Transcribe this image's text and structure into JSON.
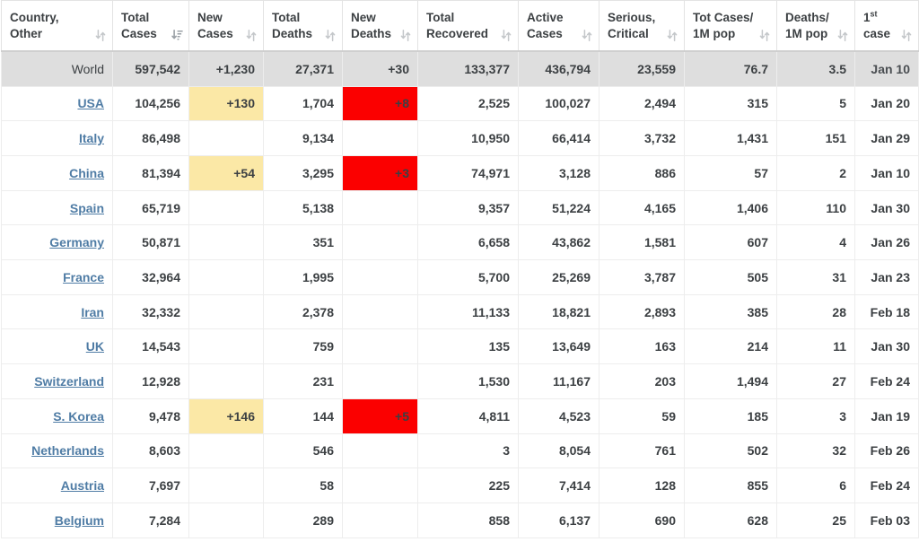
{
  "table": {
    "name": "covid-19-country-statistics-table",
    "columns": [
      {
        "line1": "Country,",
        "line2": "Other",
        "sort": "both",
        "align": "left"
      },
      {
        "line1": "Total",
        "line2": "Cases",
        "sort": "desc",
        "align": "right"
      },
      {
        "line1": "New",
        "line2": "Cases",
        "sort": "both",
        "align": "right"
      },
      {
        "line1": "Total",
        "line2": "Deaths",
        "sort": "both",
        "align": "right"
      },
      {
        "line1": "New",
        "line2": "Deaths",
        "sort": "both",
        "align": "right"
      },
      {
        "line1": "Total",
        "line2": "Recovered",
        "sort": "both",
        "align": "right"
      },
      {
        "line1": "Active",
        "line2": "Cases",
        "sort": "both",
        "align": "right"
      },
      {
        "line1": "Serious,",
        "line2": "Critical",
        "sort": "both",
        "align": "right"
      },
      {
        "line1": "Tot Cases/",
        "line2": "1M pop",
        "sort": "both",
        "align": "right"
      },
      {
        "line1": "Deaths/",
        "line2": "1M pop",
        "sort": "both",
        "align": "right"
      },
      {
        "line1": "1st",
        "line2": "case",
        "sort": "both",
        "align": "right",
        "superscript": "st",
        "base": "1"
      }
    ],
    "rows": [
      {
        "country": "World",
        "is_world": true,
        "is_link": false,
        "total_cases": "597,542",
        "new_cases": "+1,230",
        "total_deaths": "27,371",
        "new_deaths": "+30",
        "total_recovered": "133,377",
        "active_cases": "436,794",
        "serious_critical": "23,559",
        "cases_per_1m": "76.7",
        "deaths_per_1m": "3.5",
        "first_case": "Jan 10",
        "hl_new_cases": false,
        "hl_new_deaths": false
      },
      {
        "country": "USA",
        "is_world": false,
        "is_link": true,
        "total_cases": "104,256",
        "new_cases": "+130",
        "total_deaths": "1,704",
        "new_deaths": "+8",
        "total_recovered": "2,525",
        "active_cases": "100,027",
        "serious_critical": "2,494",
        "cases_per_1m": "315",
        "deaths_per_1m": "5",
        "first_case": "Jan 20",
        "hl_new_cases": true,
        "hl_new_deaths": true
      },
      {
        "country": "Italy",
        "is_world": false,
        "is_link": true,
        "total_cases": "86,498",
        "new_cases": "",
        "total_deaths": "9,134",
        "new_deaths": "",
        "total_recovered": "10,950",
        "active_cases": "66,414",
        "serious_critical": "3,732",
        "cases_per_1m": "1,431",
        "deaths_per_1m": "151",
        "first_case": "Jan 29",
        "hl_new_cases": false,
        "hl_new_deaths": false
      },
      {
        "country": "China",
        "is_world": false,
        "is_link": true,
        "total_cases": "81,394",
        "new_cases": "+54",
        "total_deaths": "3,295",
        "new_deaths": "+3",
        "total_recovered": "74,971",
        "active_cases": "3,128",
        "serious_critical": "886",
        "cases_per_1m": "57",
        "deaths_per_1m": "2",
        "first_case": "Jan 10",
        "hl_new_cases": true,
        "hl_new_deaths": true
      },
      {
        "country": "Spain",
        "is_world": false,
        "is_link": true,
        "total_cases": "65,719",
        "new_cases": "",
        "total_deaths": "5,138",
        "new_deaths": "",
        "total_recovered": "9,357",
        "active_cases": "51,224",
        "serious_critical": "4,165",
        "cases_per_1m": "1,406",
        "deaths_per_1m": "110",
        "first_case": "Jan 30",
        "hl_new_cases": false,
        "hl_new_deaths": false
      },
      {
        "country": "Germany",
        "is_world": false,
        "is_link": true,
        "total_cases": "50,871",
        "new_cases": "",
        "total_deaths": "351",
        "new_deaths": "",
        "total_recovered": "6,658",
        "active_cases": "43,862",
        "serious_critical": "1,581",
        "cases_per_1m": "607",
        "deaths_per_1m": "4",
        "first_case": "Jan 26",
        "hl_new_cases": false,
        "hl_new_deaths": false
      },
      {
        "country": "France",
        "is_world": false,
        "is_link": true,
        "total_cases": "32,964",
        "new_cases": "",
        "total_deaths": "1,995",
        "new_deaths": "",
        "total_recovered": "5,700",
        "active_cases": "25,269",
        "serious_critical": "3,787",
        "cases_per_1m": "505",
        "deaths_per_1m": "31",
        "first_case": "Jan 23",
        "hl_new_cases": false,
        "hl_new_deaths": false
      },
      {
        "country": "Iran",
        "is_world": false,
        "is_link": true,
        "total_cases": "32,332",
        "new_cases": "",
        "total_deaths": "2,378",
        "new_deaths": "",
        "total_recovered": "11,133",
        "active_cases": "18,821",
        "serious_critical": "2,893",
        "cases_per_1m": "385",
        "deaths_per_1m": "28",
        "first_case": "Feb 18",
        "hl_new_cases": false,
        "hl_new_deaths": false
      },
      {
        "country": "UK",
        "is_world": false,
        "is_link": true,
        "total_cases": "14,543",
        "new_cases": "",
        "total_deaths": "759",
        "new_deaths": "",
        "total_recovered": "135",
        "active_cases": "13,649",
        "serious_critical": "163",
        "cases_per_1m": "214",
        "deaths_per_1m": "11",
        "first_case": "Jan 30",
        "hl_new_cases": false,
        "hl_new_deaths": false
      },
      {
        "country": "Switzerland",
        "is_world": false,
        "is_link": true,
        "total_cases": "12,928",
        "new_cases": "",
        "total_deaths": "231",
        "new_deaths": "",
        "total_recovered": "1,530",
        "active_cases": "11,167",
        "serious_critical": "203",
        "cases_per_1m": "1,494",
        "deaths_per_1m": "27",
        "first_case": "Feb 24",
        "hl_new_cases": false,
        "hl_new_deaths": false
      },
      {
        "country": "S. Korea",
        "is_world": false,
        "is_link": true,
        "total_cases": "9,478",
        "new_cases": "+146",
        "total_deaths": "144",
        "new_deaths": "+5",
        "total_recovered": "4,811",
        "active_cases": "4,523",
        "serious_critical": "59",
        "cases_per_1m": "185",
        "deaths_per_1m": "3",
        "first_case": "Jan 19",
        "hl_new_cases": true,
        "hl_new_deaths": true
      },
      {
        "country": "Netherlands",
        "is_world": false,
        "is_link": true,
        "total_cases": "8,603",
        "new_cases": "",
        "total_deaths": "546",
        "new_deaths": "",
        "total_recovered": "3",
        "active_cases": "8,054",
        "serious_critical": "761",
        "cases_per_1m": "502",
        "deaths_per_1m": "32",
        "first_case": "Feb 26",
        "hl_new_cases": false,
        "hl_new_deaths": false
      },
      {
        "country": "Austria",
        "is_world": false,
        "is_link": true,
        "total_cases": "7,697",
        "new_cases": "",
        "total_deaths": "58",
        "new_deaths": "",
        "total_recovered": "225",
        "active_cases": "7,414",
        "serious_critical": "128",
        "cases_per_1m": "855",
        "deaths_per_1m": "6",
        "first_case": "Feb 24",
        "hl_new_cases": false,
        "hl_new_deaths": false
      },
      {
        "country": "Belgium",
        "is_world": false,
        "is_link": true,
        "total_cases": "7,284",
        "new_cases": "",
        "total_deaths": "289",
        "new_deaths": "",
        "total_recovered": "858",
        "active_cases": "6,137",
        "serious_critical": "690",
        "cases_per_1m": "628",
        "deaths_per_1m": "25",
        "first_case": "Feb 03",
        "hl_new_cases": false,
        "hl_new_deaths": false
      }
    ]
  },
  "colors": {
    "new_cases_highlight": "#fbe8a6",
    "new_deaths_highlight": "#fb0000",
    "world_row_background": "#dedede",
    "link": "#4f7ca5",
    "text": "#3c4043",
    "border": "#ededed"
  }
}
